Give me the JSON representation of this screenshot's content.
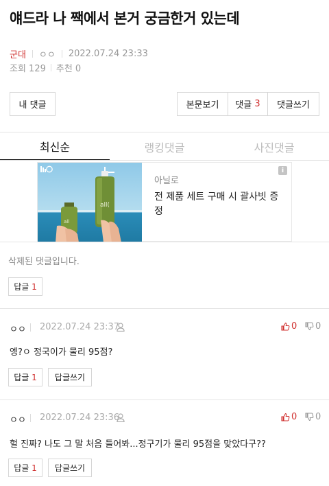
{
  "post": {
    "title": "얘드라 나 짹에서 본거 궁금한거 있는데",
    "board": "군대",
    "author": "ㅇㅇ",
    "date": "2022.07.24 23:33",
    "views_label": "조회 129",
    "recommend_label": "추천 0"
  },
  "actions": {
    "my_comments": "내 댓글",
    "view_post": "본문보기",
    "comments_label": "댓글",
    "comments_count": "3",
    "write_comment": "댓글쓰기"
  },
  "tabs": [
    {
      "label": "최신순",
      "active": true
    },
    {
      "label": "랭킹댓글",
      "active": false
    },
    {
      "label": "사진댓글",
      "active": false
    }
  ],
  "ad": {
    "brand": "아닐로",
    "text": "전 제품 세트 구매 시 괄사빗 증정",
    "info": "i"
  },
  "deleted_comment": {
    "text": "삭제된 댓글입니다.",
    "reply_label": "답글",
    "reply_count": "1"
  },
  "comments": [
    {
      "author": "ㅇㅇ",
      "date": "2022.07.24 23:37",
      "up": "0",
      "down": "0",
      "body": "엥?ㅇ 정국이가 물리 95점?",
      "reply_label": "답글",
      "reply_count": "1",
      "write_reply": "답글쓰기"
    },
    {
      "author": "ㅇㅇ",
      "date": "2022.07.24 23:36",
      "up": "0",
      "down": "0",
      "body": "헐 진짜? 나도 그 말 처음 들어봐...정구기가 물리 95점을 맞았다구??",
      "reply_label": "답글",
      "reply_count": "1",
      "write_reply": "답글쓰기"
    }
  ],
  "colors": {
    "accent": "#d0302f",
    "muted": "#999999",
    "border": "#d6d6d6"
  }
}
